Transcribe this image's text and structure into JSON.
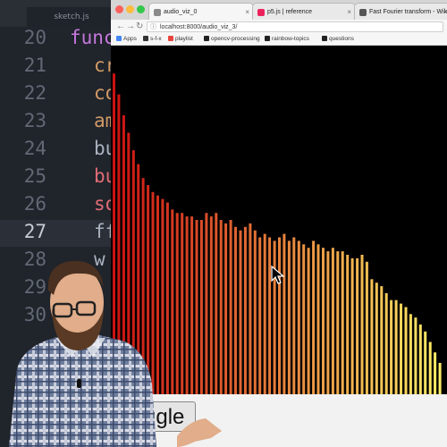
{
  "editor": {
    "file_tab": "sketch.js",
    "line_numbers": [
      "20",
      "21",
      "22",
      "23",
      "24",
      "25",
      "26",
      "27",
      "28",
      "29",
      "30"
    ],
    "current_line": "27",
    "code_fragments": [
      {
        "text": "func",
        "color": "#c678dd"
      },
      {
        "text": "cr",
        "color": "#d19a66"
      },
      {
        "text": "co",
        "color": "#d19a66"
      },
      {
        "text": "am",
        "color": "#d19a66"
      },
      {
        "text": "bu",
        "color": "#abb2bf"
      },
      {
        "text": "bu",
        "color": "#e06c75"
      },
      {
        "text": "so",
        "color": "#e06c75"
      },
      {
        "text": "ff",
        "color": "#abb2bf"
      },
      {
        "text": "w",
        "color": "#abb2bf"
      }
    ]
  },
  "browser": {
    "tabs": [
      {
        "title": "audio_viz_0",
        "icon_color": "#8a8a8a",
        "active": true
      },
      {
        "title": "p5.js | reference",
        "icon_color": "#ed225d",
        "active": false
      },
      {
        "title": "Fast Fourier transform - Wiki",
        "icon_color": "#555555",
        "active": false
      }
    ],
    "url": "localhost:8000/audio_viz_3/",
    "bookmarks": [
      {
        "label": "Apps",
        "icon_color": "#4285f4"
      },
      {
        "label": "s-f-x",
        "icon_color": "#333333"
      },
      {
        "label": "playlist",
        "icon_color": "#e8453c"
      },
      {
        "label": "opencv-processing",
        "icon_color": "#222222"
      },
      {
        "label": "rainbow-topics",
        "icon_color": "#222222"
      },
      {
        "label": "questions",
        "icon_color": "#222222"
      }
    ],
    "toggle_label": "toggle"
  },
  "chart_data": {
    "type": "bar",
    "title": "",
    "xlabel": "",
    "ylabel": "",
    "ylim": [
      0,
      1
    ],
    "color_gradient": [
      "#cc1111",
      "#ffee66"
    ],
    "values": [
      0.92,
      0.86,
      0.8,
      0.75,
      0.7,
      0.66,
      0.62,
      0.6,
      0.58,
      0.57,
      0.56,
      0.55,
      0.53,
      0.52,
      0.52,
      0.51,
      0.51,
      0.5,
      0.5,
      0.52,
      0.51,
      0.52,
      0.5,
      0.49,
      0.5,
      0.48,
      0.47,
      0.48,
      0.49,
      0.47,
      0.45,
      0.46,
      0.45,
      0.44,
      0.45,
      0.46,
      0.44,
      0.45,
      0.44,
      0.43,
      0.42,
      0.44,
      0.43,
      0.42,
      0.41,
      0.42,
      0.41,
      0.41,
      0.4,
      0.39,
      0.39,
      0.4,
      0.38,
      0.33,
      0.32,
      0.31,
      0.29,
      0.27,
      0.27,
      0.26,
      0.25,
      0.23,
      0.22,
      0.2,
      0.18,
      0.15,
      0.12,
      0.09
    ]
  }
}
